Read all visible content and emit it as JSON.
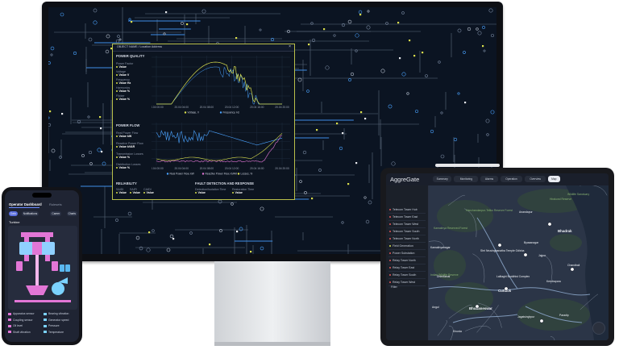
{
  "monitor": {
    "popup": {
      "header": "OBJECT NAME / Location Address",
      "power_quality": {
        "title": "POWER QUALITY",
        "items": [
          {
            "label": "Power Factor",
            "value": "Value"
          },
          {
            "label": "Voltage",
            "value": "Value V"
          },
          {
            "label": "Frequency",
            "value": "Value Hz"
          },
          {
            "label": "Harmonics",
            "value": "Value %"
          },
          {
            "label": "Flicker",
            "value": "Value %"
          }
        ],
        "ticks": [
          "20.04 00:00",
          "20.04 04:00",
          "20.04 08:00",
          "20.04 12:00",
          "20.04 16:00",
          "20.04 20:00"
        ],
        "legend": [
          "Voltage, V",
          "Frequency, Hz"
        ]
      },
      "power_flow": {
        "title": "POWER FLOW",
        "items": [
          {
            "label": "Real Power Flow",
            "value": "Value kW"
          },
          {
            "label": "Reactive Power Flow",
            "value": "Value kVAR"
          },
          {
            "label": "Transmission Losses",
            "value": "Value %"
          },
          {
            "label": "Distribution Losses",
            "value": "Value %"
          }
        ],
        "ticks": [
          "20.04 00:00",
          "20.04 04:00",
          "20.04 08:00",
          "20.04 12:00",
          "20.04 16:00",
          "20.04 20:00"
        ],
        "legend": [
          "Real Power Flow, kW",
          "Reactive Power Flow, kVAR",
          "Losses, %"
        ]
      },
      "reliability": {
        "title": "RELIABILITY",
        "items": [
          {
            "label": "SAIDI",
            "value": "Value"
          },
          {
            "label": "SAIFI",
            "value": "Value"
          },
          {
            "label": "CAIDI",
            "value": "Value"
          }
        ]
      },
      "fault": {
        "title": "FAULT DETECTION AND RESPONSE",
        "items": [
          {
            "label": "Detection/Isolation Time",
            "value": "Value"
          },
          {
            "label": "Restoration Time",
            "value": "Value"
          }
        ]
      }
    }
  },
  "phone": {
    "title": "Operator Dashboard",
    "tab_label": "Rulesets",
    "chips": [
      "Data",
      "Notifications",
      "Career",
      "Charts",
      "Market Vue"
    ],
    "section": "Turbine",
    "legend": [
      "Apparatus sensor",
      "Bearing vibration",
      "Coupling sensor",
      "Generator speed",
      "Oil level",
      "Pressure",
      "Shaft vibration",
      "Temperature"
    ]
  },
  "tablet": {
    "logo": "AggreGate",
    "tabs": [
      "Summary",
      "Monitoring",
      "Alarms",
      "Operation",
      "Overview",
      "Map"
    ],
    "sidebar": [
      "Telecom Tower Hub",
      "Telecom Tower East",
      "Telecom Tower West",
      "Telecom Tower South",
      "Telecom Tower North",
      "Field Generation",
      "Power Substation",
      "Relay Tower North",
      "Relay Tower East",
      "Relay Tower South",
      "Relay Tower West"
    ],
    "sidebar_footer": "Filter",
    "map_labels": {
      "reserve1": "Hirakund Reserve",
      "reserve2": "Wildlife Sanctuary",
      "reserve3": "Hanchandanpur-Teliko Reserve Forest",
      "forest2": "Kamakhya Reserved Forest",
      "forest3": "Indian Wildlife Reserve",
      "city1": "Anandapur",
      "city2": "Bhadrak",
      "city3": "Kamakhyanagar",
      "city4": "Dhenkanal",
      "city5": "Cuttack",
      "city6": "Bhubaneswar",
      "city7": "Jajpur",
      "city8": "Chandbali",
      "city9": "Kendrapara",
      "city10": "Jagatsinghpur",
      "city11": "Paradip",
      "city12": "Angul",
      "temple": "Shri Nrusinghanatha Temple Odisha",
      "bd": "Lalitagiri Buddhist Complex",
      "city13": "Byasanagar",
      "city14": "Khurda"
    }
  },
  "colors": {
    "accent_yellow": "#d9de4c",
    "accent_blue": "#4aa3ff",
    "phone_pink": "#e276d6",
    "phone_cyan": "#7bd2ff"
  }
}
